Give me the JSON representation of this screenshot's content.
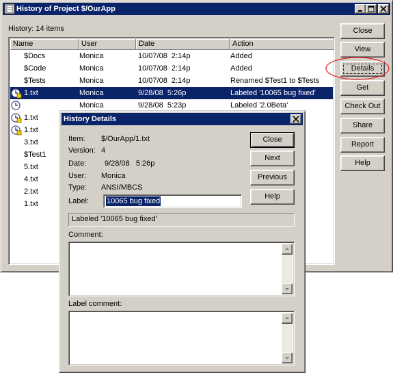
{
  "main_window": {
    "title": "History of Project $/OurApp",
    "history_label": "History: 14 items",
    "columns": [
      "Name",
      "User",
      "Date",
      "Action"
    ],
    "rows": [
      {
        "name": "$Docs",
        "user": "Monica",
        "date": "10/07/08  2:14p",
        "action": "Added",
        "icon": "none"
      },
      {
        "name": "$Code",
        "user": "Monica",
        "date": "10/07/08  2:14p",
        "action": "Added",
        "icon": "none"
      },
      {
        "name": "$Tests",
        "user": "Monica",
        "date": "10/07/08  2:14p",
        "action": "Renamed $Test1 to $Tests",
        "icon": "none"
      },
      {
        "name": "1.txt",
        "user": "Monica",
        "date": "9/28/08  5:26p",
        "action": "Labeled '10065 bug fixed'",
        "icon": "label-clock-icon",
        "selected": true
      },
      {
        "name": "",
        "user": "Monica",
        "date": "9/28/08  5:23p",
        "action": "Labeled '2.0Beta'",
        "icon": "clock-icon"
      },
      {
        "name": "1.txt",
        "user": "",
        "date": "",
        "action": "",
        "icon": "label-clock-icon"
      },
      {
        "name": "1.txt",
        "user": "",
        "date": "",
        "action": "",
        "icon": "label-clock-icon"
      },
      {
        "name": "3.txt",
        "user": "",
        "date": "",
        "action": "",
        "icon": "none"
      },
      {
        "name": "$Test1",
        "user": "",
        "date": "",
        "action": "",
        "icon": "none"
      },
      {
        "name": "5.txt",
        "user": "",
        "date": "",
        "action": "",
        "icon": "none"
      },
      {
        "name": "4.txt",
        "user": "",
        "date": "",
        "action": "",
        "icon": "none"
      },
      {
        "name": "2.txt",
        "user": "",
        "date": "",
        "action": "",
        "icon": "none"
      },
      {
        "name": "1.txt",
        "user": "",
        "date": "",
        "action": "",
        "icon": "none"
      }
    ],
    "buttons": [
      "Close",
      "View",
      "Details",
      "Get",
      "Check Out",
      "Share",
      "Report",
      "Help"
    ],
    "highlight_color": "#e02020"
  },
  "details_dialog": {
    "title": "History Details",
    "fields": {
      "item_label": "Item:",
      "item_value": "$/OurApp/1.txt",
      "version_label": "Version:",
      "version_value": "4",
      "date_label": "Date:",
      "date_value": "9/28/08   5:26p",
      "user_label": "User:",
      "user_value": "Monica",
      "type_label": "Type:",
      "type_value": "ANSI/MBCS",
      "label_label": "Label:",
      "label_value": "10065 bug fixed"
    },
    "status_text": "Labeled '10065 bug fixed'",
    "comment_label": "Comment:",
    "label_comment_label": "Label comment:",
    "buttons": [
      "Close",
      "Next",
      "Previous",
      "Help"
    ]
  },
  "colors": {
    "face": "#d4d0c8",
    "title_bar": "#0a246a",
    "selection": "#0a246a"
  }
}
